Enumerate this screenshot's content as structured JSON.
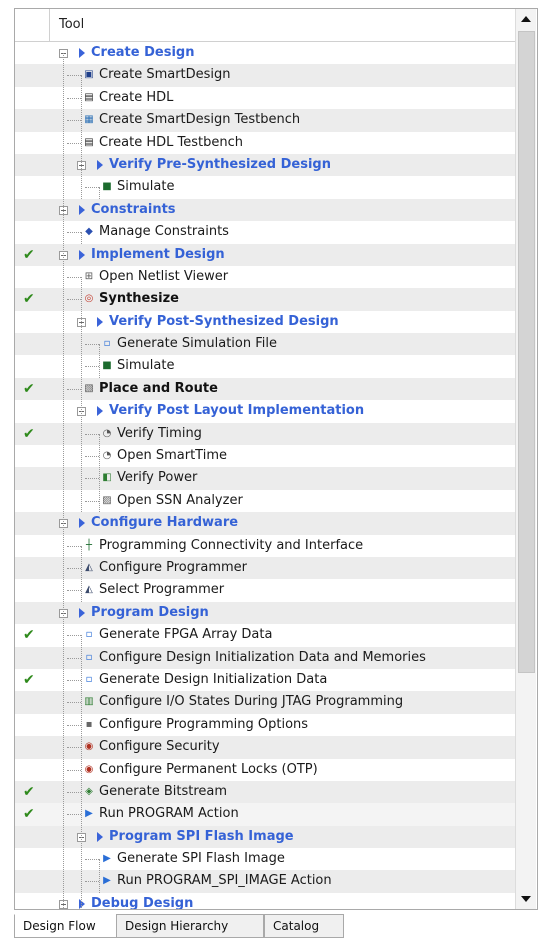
{
  "tree": {
    "header": "Tool",
    "rows": [
      {
        "label": "Create Design",
        "kind": "group",
        "level": 0,
        "check": false,
        "icon": "group"
      },
      {
        "label": "Create SmartDesign",
        "kind": "item",
        "level": 1,
        "check": false,
        "icon": "smartdesign-icon"
      },
      {
        "label": "Create HDL",
        "kind": "item",
        "level": 1,
        "check": false,
        "icon": "hdl-icon"
      },
      {
        "label": "Create SmartDesign Testbench",
        "kind": "item",
        "level": 1,
        "check": false,
        "icon": "sd-testbench-icon"
      },
      {
        "label": "Create HDL Testbench",
        "kind": "item",
        "level": 1,
        "check": false,
        "icon": "hdl-icon"
      },
      {
        "label": "Verify Pre-Synthesized Design",
        "kind": "group",
        "level": 1,
        "check": false,
        "icon": "group"
      },
      {
        "label": "Simulate",
        "kind": "item",
        "level": 2,
        "check": false,
        "icon": "simulate-icon"
      },
      {
        "label": "Constraints",
        "kind": "group",
        "level": 0,
        "check": false,
        "icon": "group"
      },
      {
        "label": "Manage Constraints",
        "kind": "item",
        "level": 1,
        "check": false,
        "icon": "constraints-icon"
      },
      {
        "label": "Implement Design",
        "kind": "group",
        "level": 0,
        "check": true,
        "icon": "group"
      },
      {
        "label": "Open Netlist Viewer",
        "kind": "item",
        "level": 1,
        "check": false,
        "icon": "netlist-icon"
      },
      {
        "label": "Synthesize",
        "kind": "bold",
        "level": 1,
        "check": true,
        "icon": "synthesize-icon"
      },
      {
        "label": "Verify Post-Synthesized Design",
        "kind": "group",
        "level": 1,
        "check": false,
        "icon": "group"
      },
      {
        "label": "Generate Simulation File",
        "kind": "item",
        "level": 2,
        "check": false,
        "icon": "generate-file-icon"
      },
      {
        "label": "Simulate",
        "kind": "item",
        "level": 2,
        "check": false,
        "icon": "simulate-icon"
      },
      {
        "label": "Place and Route",
        "kind": "bold",
        "level": 1,
        "check": true,
        "icon": "place-route-icon"
      },
      {
        "label": "Verify Post Layout Implementation",
        "kind": "group",
        "level": 1,
        "check": false,
        "icon": "group"
      },
      {
        "label": "Verify Timing",
        "kind": "item",
        "level": 2,
        "check": true,
        "icon": "timing-icon"
      },
      {
        "label": "Open SmartTime",
        "kind": "item",
        "level": 2,
        "check": false,
        "icon": "smarttime-icon"
      },
      {
        "label": "Verify Power",
        "kind": "item",
        "level": 2,
        "check": false,
        "icon": "power-icon"
      },
      {
        "label": "Open SSN Analyzer",
        "kind": "item",
        "level": 2,
        "check": false,
        "icon": "ssn-icon"
      },
      {
        "label": "Configure Hardware",
        "kind": "group",
        "level": 0,
        "check": false,
        "icon": "group"
      },
      {
        "label": "Programming Connectivity and Interface",
        "kind": "item",
        "level": 1,
        "check": false,
        "icon": "connectivity-icon"
      },
      {
        "label": "Configure Programmer",
        "kind": "item",
        "level": 1,
        "check": false,
        "icon": "programmer-icon"
      },
      {
        "label": "Select Programmer",
        "kind": "item",
        "level": 1,
        "check": false,
        "icon": "programmer-icon"
      },
      {
        "label": "Program Design",
        "kind": "group",
        "level": 0,
        "check": false,
        "icon": "group"
      },
      {
        "label": "Generate FPGA Array Data",
        "kind": "item",
        "level": 1,
        "check": true,
        "icon": "generate-file-icon"
      },
      {
        "label": "Configure Design Initialization Data and Memories",
        "kind": "item",
        "level": 1,
        "check": false,
        "icon": "generate-file-icon"
      },
      {
        "label": "Generate Design Initialization Data",
        "kind": "item",
        "level": 1,
        "check": true,
        "icon": "generate-file-icon"
      },
      {
        "label": "Configure I/O States During JTAG Programming",
        "kind": "item",
        "level": 1,
        "check": false,
        "icon": "io-states-icon"
      },
      {
        "label": "Configure Programming Options",
        "kind": "item",
        "level": 1,
        "check": false,
        "icon": "options-icon"
      },
      {
        "label": "Configure Security",
        "kind": "item",
        "level": 1,
        "check": false,
        "icon": "security-icon"
      },
      {
        "label": "Configure Permanent Locks (OTP)",
        "kind": "item",
        "level": 1,
        "check": false,
        "icon": "security-icon"
      },
      {
        "label": "Generate Bitstream",
        "kind": "item",
        "level": 1,
        "check": true,
        "icon": "bitstream-icon"
      },
      {
        "label": "Run PROGRAM Action",
        "kind": "item",
        "level": 1,
        "check": true,
        "icon": "run-action-icon"
      },
      {
        "label": "Program SPI Flash Image",
        "kind": "group",
        "level": 1,
        "check": false,
        "icon": "group"
      },
      {
        "label": "Generate SPI Flash Image",
        "kind": "item",
        "level": 2,
        "check": false,
        "icon": "run-action-icon"
      },
      {
        "label": "Run PROGRAM_SPI_IMAGE Action",
        "kind": "item",
        "level": 2,
        "check": false,
        "icon": "run-action-icon"
      },
      {
        "label": "Debug Design",
        "kind": "group",
        "level": 0,
        "check": false,
        "icon": "group"
      }
    ]
  },
  "tabs": [
    "Design Flow",
    "Design Hierarchy",
    "Catalog"
  ],
  "active_tab": "Design Flow",
  "colors": {
    "group_text": "#3562d6",
    "check": "#2f8a1c",
    "alt_row": "#ececec"
  }
}
